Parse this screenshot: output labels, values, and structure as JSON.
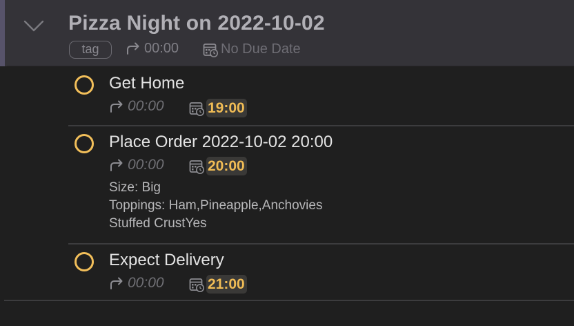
{
  "colors": {
    "header_background": "#343338",
    "accent_bar": "#57536a",
    "checkbox_ring": "#f2bf5a",
    "due_time": "#f0bc55",
    "background": "#1f1f1f"
  },
  "project": {
    "title": "Pizza Night on 2022-10-02",
    "tag": "tag",
    "repeat": "00:00",
    "due": "No Due Date",
    "icons": {
      "collapse": "chevron-down-icon",
      "repeat": "repeat-arrow-icon",
      "due": "calendar-clock-icon"
    }
  },
  "tasks": [
    {
      "title": "Get Home",
      "repeat": "00:00",
      "due": "19:00"
    },
    {
      "title": "Place Order 2022-10-02 20:00",
      "repeat": "00:00",
      "due": "20:00",
      "notes": [
        "Size: Big",
        "Toppings: Ham,Pineapple,Anchovies",
        "Stuffed CrustYes"
      ]
    },
    {
      "title": "Expect Delivery",
      "repeat": "00:00",
      "due": "21:00"
    }
  ]
}
